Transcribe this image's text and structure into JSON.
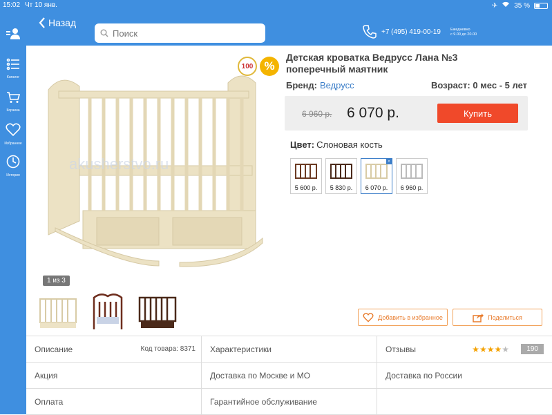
{
  "status": {
    "time": "15:02",
    "date": "Чт 10 янв.",
    "battery": "35 %",
    "battery_level": 0.35
  },
  "header": {
    "back_label": "Назад",
    "search_placeholder": "Поиск",
    "phone": "+7 (495) 419-00-19",
    "hours_line1": "Ежедневно",
    "hours_line2": "с 9.00 до 20.00"
  },
  "sidebar": {
    "items": [
      {
        "label": "",
        "icon": "user-icon"
      },
      {
        "label": "Каталог",
        "icon": "catalog-icon"
      },
      {
        "label": "Корзина",
        "icon": "cart-icon"
      },
      {
        "label": "Избранное",
        "icon": "heart-icon"
      },
      {
        "label": "История",
        "icon": "clock-icon"
      }
    ]
  },
  "product": {
    "title_line1": "Детская кроватка Ведрусс Лана №3",
    "title_line2": "поперечный маятник",
    "brand_label": "Бренд:",
    "brand_value": "Ведрусс",
    "age": "Возраст: 0 мес - 5 лет",
    "old_price": "6 960 р.",
    "price": "6 070 р.",
    "buy_label": "Купить",
    "color_label": "Цвет:",
    "color_value": "Слоновая кость",
    "badge_text": "100",
    "badge_pct": "%",
    "photo_counter": "1 из 3",
    "watermark": "akusherstvo.ru",
    "swatches": [
      {
        "price": "5 600 р.",
        "color": "#6b3a22"
      },
      {
        "price": "5 830 р.",
        "color": "#4b2a1a"
      },
      {
        "price": "6 070 р.",
        "color": "#e9dfc4",
        "selected": true
      },
      {
        "price": "6 960 р.",
        "color": "#f4f4f4"
      }
    ],
    "thumb_colors": [
      "#ede3c6",
      "#6e2e1e",
      "#4b2a1a"
    ],
    "fav_label": "Добавить в избранное",
    "share_label": "Поделиться"
  },
  "info": {
    "description": "Описание",
    "code": "Код товара: 8371",
    "specs": "Характеристики",
    "reviews": "Отзывы",
    "rating": 4,
    "rating_max": 5,
    "review_count": "190",
    "promo": "Акция",
    "delivery_moscow": "Доставка по Москве и МО",
    "delivery_russia": "Доставка по России",
    "payment": "Оплата",
    "warranty": "Гарантийное обслуживание"
  },
  "colors": {
    "accent": "#3f8fe0",
    "buy": "#f0492a",
    "orange": "#e87b2c",
    "link": "#3d7fc9"
  }
}
